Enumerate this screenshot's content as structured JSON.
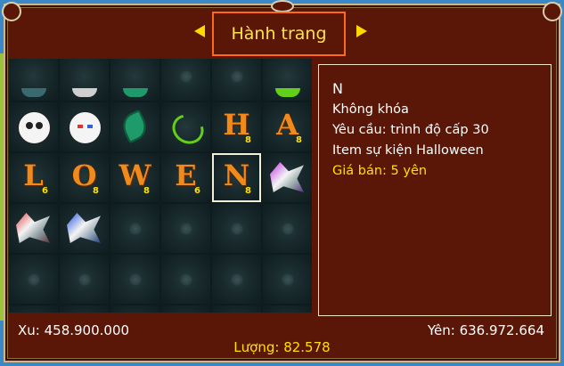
{
  "window": {
    "title": "Hành trang",
    "colors": {
      "frame": "#5a1606",
      "title_border": "#ff6a1a",
      "gold_text": "#ffe000",
      "letter": "#f08a1a"
    }
  },
  "inventory": {
    "partial_top_row": [
      {
        "icon": "monster-icon-partial"
      },
      {
        "icon": "cat-icon-partial"
      },
      {
        "icon": "leaf-icon-partial"
      },
      {
        "icon": "empty"
      },
      {
        "icon": "empty"
      },
      {
        "icon": "vine-icon-partial"
      }
    ],
    "rows": [
      [
        {
          "icon": "skull-mask-icon",
          "type": "icon"
        },
        {
          "icon": "cat-mask-icon",
          "type": "icon"
        },
        {
          "icon": "green-leaf-icon",
          "type": "icon"
        },
        {
          "icon": "green-vine-icon",
          "type": "icon"
        },
        {
          "type": "letter",
          "letter": "H",
          "qty": "8"
        },
        {
          "type": "letter",
          "letter": "A",
          "qty": "8"
        }
      ],
      [
        {
          "type": "letter",
          "letter": "L",
          "qty": "6"
        },
        {
          "type": "letter",
          "letter": "O",
          "qty": "8"
        },
        {
          "type": "letter",
          "letter": "W",
          "qty": "8"
        },
        {
          "type": "letter",
          "letter": "E",
          "qty": "6"
        },
        {
          "type": "letter",
          "letter": "N",
          "qty": "8",
          "selected": true
        },
        {
          "icon": "purple-monster-icon",
          "type": "icon"
        }
      ],
      [
        {
          "icon": "red-monster-icon",
          "type": "icon"
        },
        {
          "icon": "blue-monster-icon",
          "type": "icon"
        },
        {
          "type": "empty"
        },
        {
          "type": "empty"
        },
        {
          "type": "empty"
        },
        {
          "type": "empty"
        }
      ],
      [
        {
          "type": "empty"
        },
        {
          "type": "empty"
        },
        {
          "type": "empty"
        },
        {
          "type": "empty"
        },
        {
          "type": "empty"
        },
        {
          "type": "empty"
        }
      ],
      [
        {
          "type": "empty"
        },
        {
          "type": "empty"
        },
        {
          "type": "empty"
        },
        {
          "type": "empty"
        },
        {
          "type": "empty"
        },
        {
          "type": "empty"
        }
      ]
    ]
  },
  "item_info": {
    "name": "N",
    "lock": "Không khóa",
    "requirement": "Yêu cầu: trình độ cấp 30",
    "event": "Item sự kiện Halloween",
    "price": "Giá bán: 5 yên"
  },
  "footer": {
    "xu": "Xu: 458.900.000",
    "yen": "Yên: 636.972.664",
    "luong": "Lượng: 82.578"
  }
}
